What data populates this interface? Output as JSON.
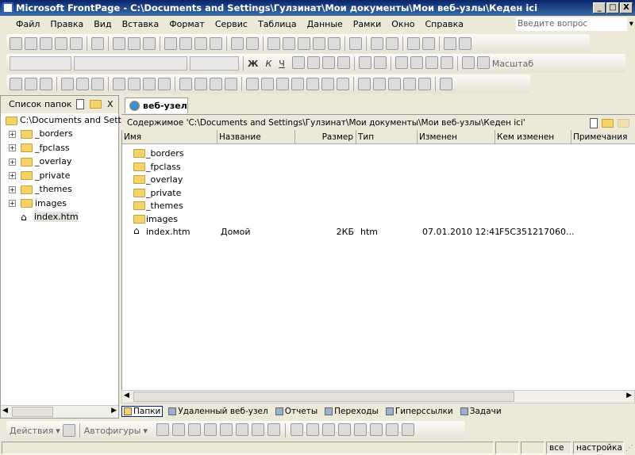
{
  "window": {
    "title": "Microsoft FrontPage - C:\\Documents and Settings\\Гулзинат\\Мои документы\\Мои веб-узлы\\Кеден ici",
    "min": "_",
    "max": "□",
    "close": "X"
  },
  "menu": [
    "Файл",
    "Правка",
    "Вид",
    "Вставка",
    "Формат",
    "Сервис",
    "Таблица",
    "Данные",
    "Рамки",
    "Окно",
    "Справка"
  ],
  "ask_placeholder": "Введите вопрос",
  "toolbar_format": {
    "bold": "Ж",
    "italic": "К",
    "underline": "Ч",
    "zoom": "Масштаб"
  },
  "folder_list": {
    "title": "Список папок",
    "close": "X",
    "root": "C:\\Documents and Setting",
    "items": [
      {
        "name": "_borders",
        "type": "folder"
      },
      {
        "name": "_fpclass",
        "type": "folder"
      },
      {
        "name": "_overlay",
        "type": "folder"
      },
      {
        "name": "_private",
        "type": "folder"
      },
      {
        "name": "_themes",
        "type": "folder"
      },
      {
        "name": "images",
        "type": "folder"
      },
      {
        "name": "index.htm",
        "type": "home"
      }
    ]
  },
  "main": {
    "tab": "веб-узел",
    "path": "Содержимое 'C:\\Documents and Settings\\Гулзинат\\Мои документы\\Мои веб-узлы\\Кеден ici'",
    "columns": [
      "Имя",
      "Название",
      "Размер",
      "Тип",
      "Изменен",
      "Кем изменен",
      "Примечания"
    ],
    "rows": [
      {
        "name": "_borders",
        "type": "folder",
        "title": "",
        "size": "",
        "ext": "",
        "modified": "",
        "by": ""
      },
      {
        "name": "_fpclass",
        "type": "folder",
        "title": "",
        "size": "",
        "ext": "",
        "modified": "",
        "by": ""
      },
      {
        "name": "_overlay",
        "type": "folder",
        "title": "",
        "size": "",
        "ext": "",
        "modified": "",
        "by": ""
      },
      {
        "name": "_private",
        "type": "folder",
        "title": "",
        "size": "",
        "ext": "",
        "modified": "",
        "by": ""
      },
      {
        "name": "_themes",
        "type": "folder",
        "title": "",
        "size": "",
        "ext": "",
        "modified": "",
        "by": ""
      },
      {
        "name": "images",
        "type": "folder",
        "title": "",
        "size": "",
        "ext": "",
        "modified": "",
        "by": ""
      },
      {
        "name": "index.htm",
        "type": "home",
        "title": "Домой",
        "size": "2КБ",
        "ext": "htm",
        "modified": "07.01.2010 12:41",
        "by": "F5C351217060..."
      }
    ]
  },
  "view_tabs": [
    "Папки",
    "Удаленный веб-узел",
    "Отчеты",
    "Переходы",
    "Гиперссылки",
    "Задачи"
  ],
  "drawing": {
    "actions": "Действия",
    "autoshapes": "Автофигуры"
  },
  "status": {
    "all": "все",
    "settings": "настройка"
  }
}
